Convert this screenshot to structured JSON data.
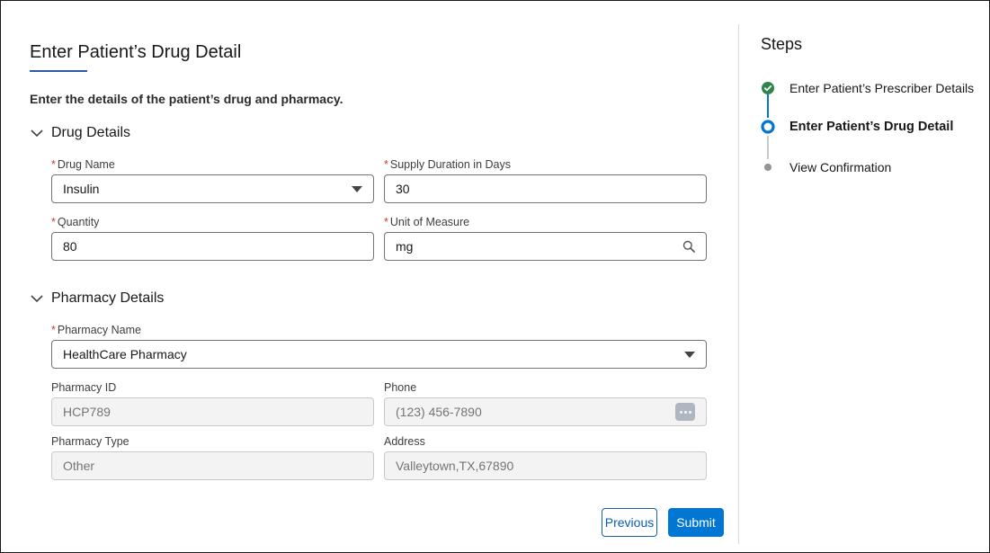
{
  "page": {
    "title": "Enter Patient’s Drug Detail",
    "instruction": "Enter the details of the patient’s drug and pharmacy."
  },
  "drug_section": {
    "title": "Drug Details",
    "drug_name": {
      "label": "Drug Name",
      "value": "Insulin"
    },
    "supply_duration": {
      "label": "Supply Duration in Days",
      "value": "30"
    },
    "quantity": {
      "label": "Quantity",
      "value": "80"
    },
    "unit_of_measure": {
      "label": "Unit of Measure",
      "value": "mg"
    }
  },
  "pharmacy_section": {
    "title": "Pharmacy Details",
    "pharmacy_name": {
      "label": "Pharmacy Name",
      "value": "HealthCare Pharmacy"
    },
    "pharmacy_id": {
      "label": "Pharmacy ID",
      "value": "HCP789"
    },
    "phone": {
      "label": "Phone",
      "value": "(123) 456-7890"
    },
    "pharmacy_type": {
      "label": "Pharmacy Type",
      "value": "Other"
    },
    "address": {
      "label": "Address",
      "value": "Valleytown,TX,67890"
    }
  },
  "buttons": {
    "previous": "Previous",
    "submit": "Submit"
  },
  "steps": {
    "title": "Steps",
    "items": [
      {
        "label": "Enter Patient’s Prescriber Details",
        "state": "complete"
      },
      {
        "label": "Enter Patient’s Drug Detail",
        "state": "active"
      },
      {
        "label": "View Confirmation",
        "state": "upcoming"
      }
    ]
  },
  "colors": {
    "brand": "#0176d3",
    "required": "#c23934",
    "complete": "#2e844a",
    "underline": "#2e5aa7"
  }
}
